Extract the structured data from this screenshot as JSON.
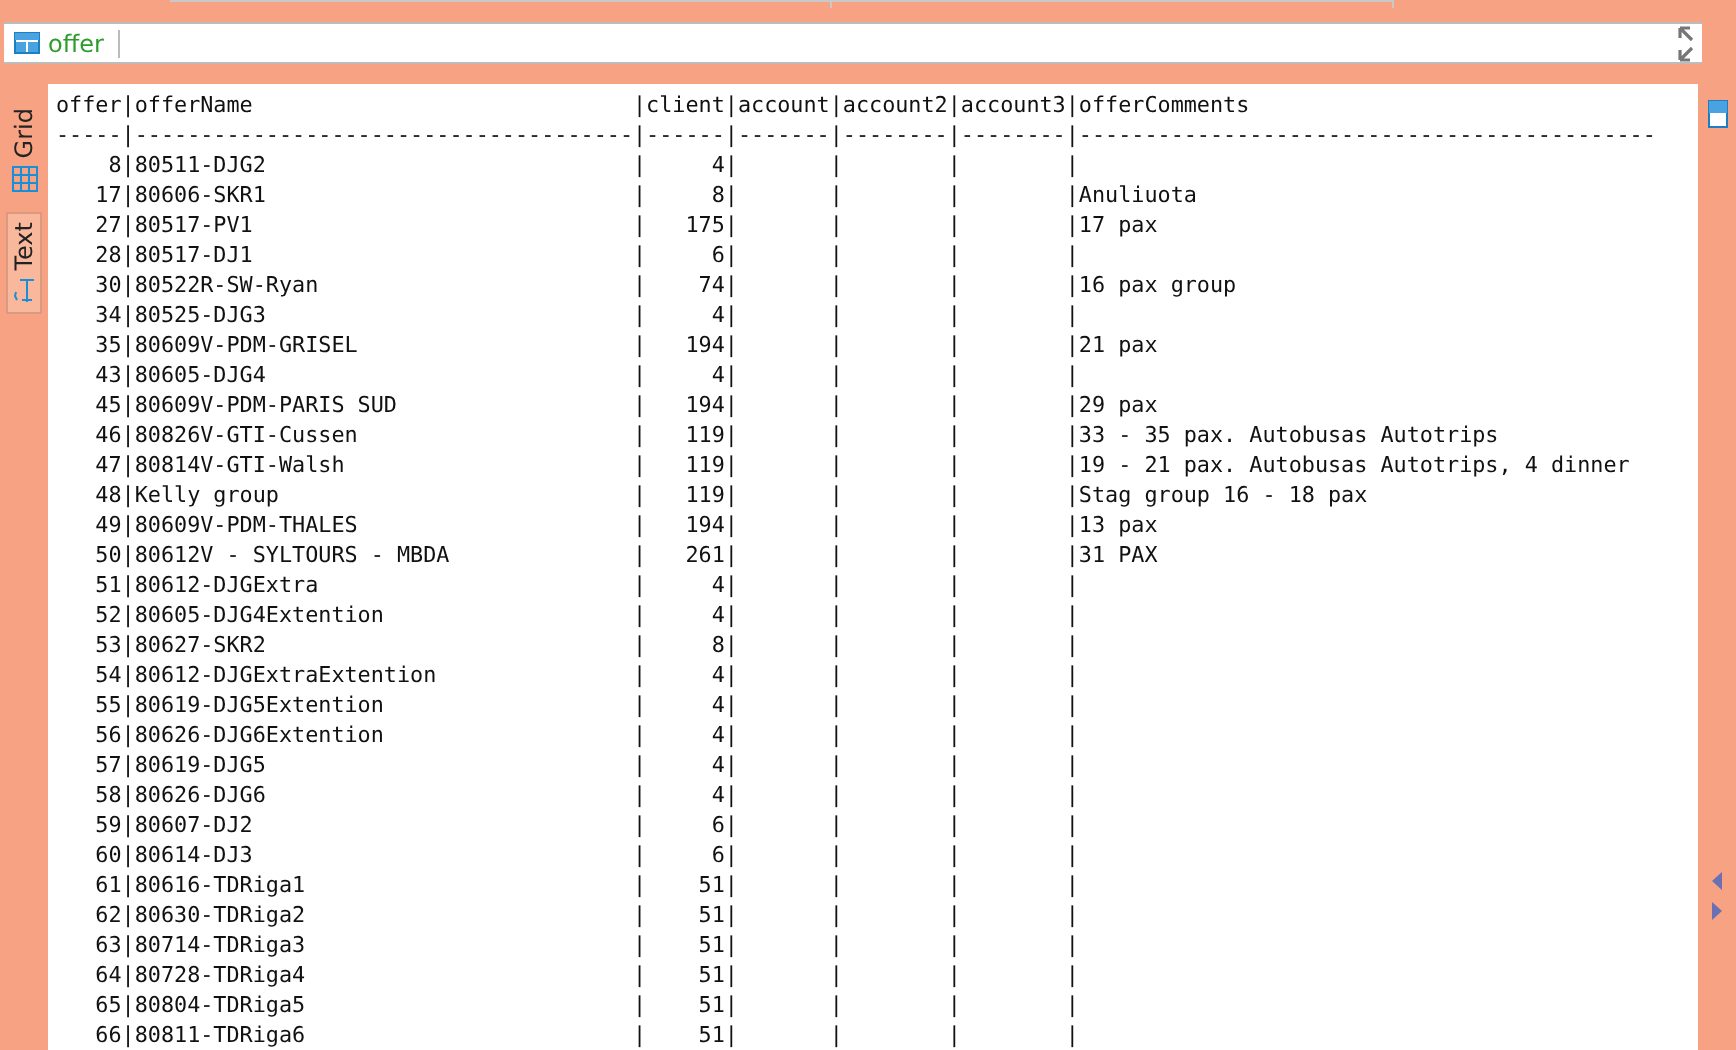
{
  "filter": {
    "table": "offer"
  },
  "side_tabs": [
    {
      "label": "Grid",
      "kind": "grid",
      "selected": false
    },
    {
      "label": "Text",
      "kind": "text",
      "selected": true
    }
  ],
  "text_lines": [
    "offer|offerName                             |client|account|account2|account3|offerComments",
    "-----|--------------------------------------|------|-------|--------|--------|--------------------------------------------",
    "    8|80511-DJG2                            |     4|       |        |        |",
    "   17|80606-SKR1                            |     8|       |        |        |Anuliuota",
    "   27|80517-PV1                             |   175|       |        |        |17 pax",
    "   28|80517-DJ1                             |     6|       |        |        |",
    "   30|80522R-SW-Ryan                        |    74|       |        |        |16 pax group",
    "   34|80525-DJG3                            |     4|       |        |        |",
    "   35|80609V-PDM-GRISEL                     |   194|       |        |        |21 pax",
    "   43|80605-DJG4                            |     4|       |        |        |",
    "   45|80609V-PDM-PARIS SUD                  |   194|       |        |        |29 pax",
    "   46|80826V-GTI-Cussen                     |   119|       |        |        |33 - 35 pax. Autobusas Autotrips",
    "   47|80814V-GTI-Walsh                      |   119|       |        |        |19 - 21 pax. Autobusas Autotrips, 4 dinner",
    "   48|Kelly group                           |   119|       |        |        |Stag group 16 - 18 pax",
    "   49|80609V-PDM-THALES                     |   194|       |        |        |13 pax",
    "   50|80612V - SYLTOURS - MBDA              |   261|       |        |        |31 PAX",
    "   51|80612-DJGExtra                        |     4|       |        |        |",
    "   52|80605-DJG4Extention                   |     4|       |        |        |",
    "   53|80627-SKR2                            |     8|       |        |        |",
    "   54|80612-DJGExtraExtention               |     4|       |        |        |",
    "   55|80619-DJG5Extention                   |     4|       |        |        |",
    "   56|80626-DJG6Extention                   |     4|       |        |        |",
    "   57|80619-DJG5                            |     4|       |        |        |",
    "   58|80626-DJG6                            |     4|       |        |        |",
    "   59|80607-DJ2                             |     6|       |        |        |",
    "   60|80614-DJ3                             |     6|       |        |        |",
    "   61|80616-TDRiga1                         |    51|       |        |        |",
    "   62|80630-TDRiga2                         |    51|       |        |        |",
    "   63|80714-TDRiga3                         |    51|       |        |        |",
    "   64|80728-TDRiga4                         |    51|       |        |        |",
    "   65|80804-TDRiga5                         |    51|       |        |        |",
    "   66|80811-TDRiga6                         |    51|       |        |        |"
  ]
}
